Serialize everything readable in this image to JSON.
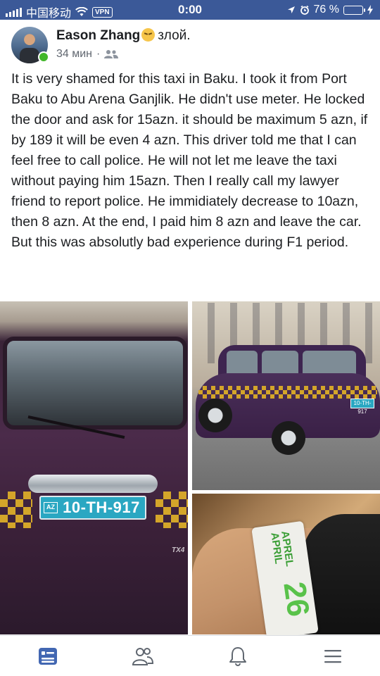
{
  "status_bar": {
    "carrier": "中国移动",
    "vpn": "VPN",
    "time": "0:00",
    "battery": "76 %",
    "battery_level": 0.76
  },
  "post": {
    "author": "Eason Zhang",
    "feeling_emoji": "angry-face",
    "feeling": "злой.",
    "time_ago": "34 мин",
    "separator": "·",
    "audience_icon": "friends-icon",
    "text": "It is very shamed for this taxi in Baku. I took it from Port Baku to Abu Arena Ganjlik. He didn't use meter. He locked the door and ask for 15azn. it should be maximum 5 azn, if by 189 it will be even 4 azn. This driver told me that I can feel free to call police. He will not let me leave the taxi without paying him 15azn. Then I really call my lawyer friend to report police. He immidiately decrease to 10azn, then 8 azn. At the end, I paid him 8 azn and leave the car. But this was absolutly bad experience during F1 period."
  },
  "photos": {
    "photo1": {
      "plate_country": "AZ",
      "plate_number": "10-TH-917",
      "model_badge": "TX4"
    },
    "photo2": {
      "plate_number": "10-TH-917"
    },
    "photo3": {
      "wristband_month_az": "APREL",
      "wristband_month_en": "APRIL",
      "wristband_day": "26"
    }
  },
  "bottom_nav": [
    {
      "name": "news-feed-icon",
      "active": true
    },
    {
      "name": "friends-icon",
      "active": false
    },
    {
      "name": "notifications-bell-icon",
      "active": false
    },
    {
      "name": "menu-icon",
      "active": false
    }
  ],
  "colors": {
    "status_bar_bg": "#3b5998",
    "nav_active": "#4267b2",
    "nav_inactive": "#606770",
    "online": "#42b72a"
  }
}
